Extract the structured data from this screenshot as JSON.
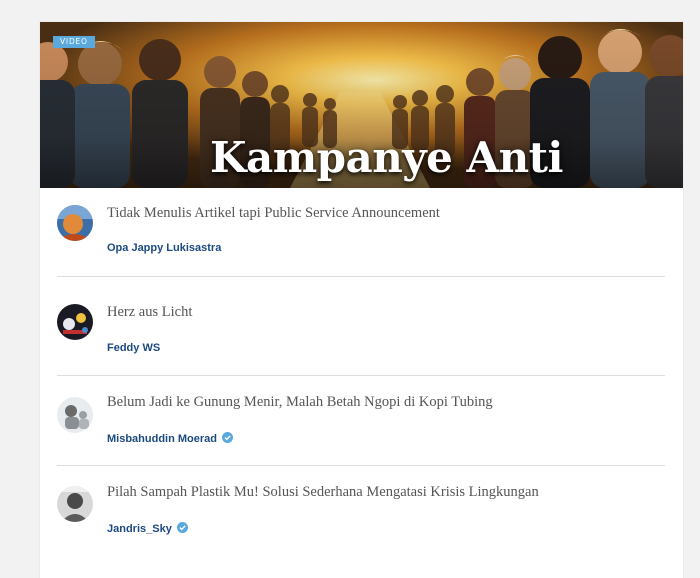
{
  "hero": {
    "badge": "VIDEO",
    "title": "Kampanye Anti"
  },
  "articles": [
    {
      "title": "Tidak Menulis Artikel tapi Public Service Announcement",
      "author": "Opa Jappy Lukisastra",
      "verified": false
    },
    {
      "title": "Herz aus Licht",
      "author": "Feddy WS",
      "verified": false
    },
    {
      "title": "Belum Jadi ke Gunung Menir, Malah Betah Ngopi di Kopi Tubing",
      "author": "Misbahuddin Moerad",
      "verified": true
    },
    {
      "title": "Pilah Sampah Plastik Mu! Solusi Sederhana Mengatasi Krisis Lingkungan",
      "author": "Jandris_Sky",
      "verified": true
    }
  ],
  "colors": {
    "badge": "#5aa9dc",
    "author": "#1c4a80",
    "verified": "#5aa9dc",
    "divider": "#dedede"
  }
}
